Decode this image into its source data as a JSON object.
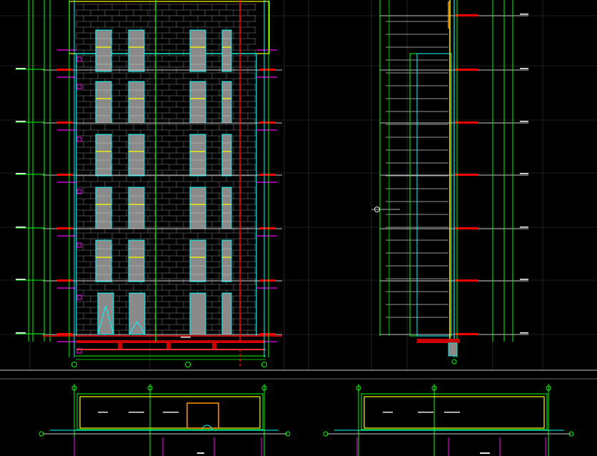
{
  "drawing": {
    "background": "#000000",
    "colors": {
      "grid": "#3a3a4a",
      "wall": "#c8c8c8",
      "green": "#00ff00",
      "cyan": "#00ffff",
      "yellow": "#ffff00",
      "magenta": "#ff00ff",
      "red": "#ff0000",
      "orange": "#ff9900",
      "window": "#8a8a8a",
      "white": "#ffffff"
    }
  }
}
